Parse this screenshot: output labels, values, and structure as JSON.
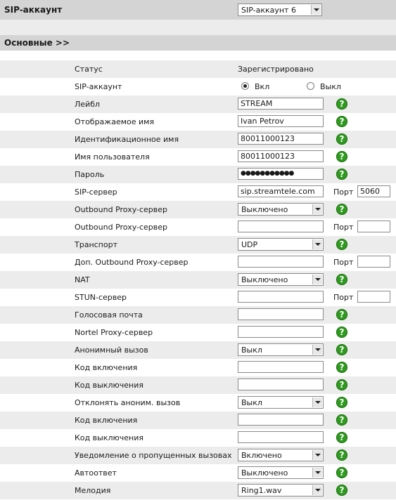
{
  "header": {
    "title": "SIP-аккаунт",
    "account_select": "SIP-аккаунт 6"
  },
  "section": {
    "title": "Основные >>"
  },
  "fields": {
    "status": {
      "label": "Статус",
      "value": "Зарегистрировано"
    },
    "sip_account": {
      "label": "SIP-аккаунт",
      "on_label": "Вкл",
      "off_label": "Выкл",
      "selected": "on"
    },
    "label": {
      "label": "Лейбл",
      "value": "STREAM"
    },
    "display_name": {
      "label": "Отображаемое имя",
      "value": "Ivan Petrov"
    },
    "auth_name": {
      "label": "Идентификационное имя",
      "value": "80011000123"
    },
    "user_name": {
      "label": "Имя пользователя",
      "value": "80011000123"
    },
    "password": {
      "label": "Пароль",
      "value": "●●●●●●●●●●●"
    },
    "sip_server": {
      "label": "SIP-сервер",
      "value": "sip.streamtele.com",
      "port_label": "Порт",
      "port": "5060"
    },
    "outbound_proxy_mode": {
      "label": "Outbound Proxy-сервер",
      "value": "Выключено"
    },
    "outbound_proxy": {
      "label": "Outbound Proxy-сервер",
      "value": "",
      "port_label": "Порт",
      "port": ""
    },
    "transport": {
      "label": "Транспорт",
      "value": "UDP"
    },
    "backup_outbound_proxy": {
      "label": "Доп. Outbound Proxy-сервер",
      "value": "",
      "port_label": "Порт",
      "port": ""
    },
    "nat": {
      "label": "NAT",
      "value": "Выключено"
    },
    "stun_server": {
      "label": "STUN-сервер",
      "value": "",
      "port_label": "Порт",
      "port": ""
    },
    "voicemail": {
      "label": "Голосовая почта",
      "value": ""
    },
    "nortel_proxy": {
      "label": "Nortel Proxy-сервер",
      "value": ""
    },
    "anonymous_call": {
      "label": "Анонимный вызов",
      "value": "Выкл"
    },
    "anon_on_code": {
      "label": "Код включения",
      "value": ""
    },
    "anon_off_code": {
      "label": "Код выключения",
      "value": ""
    },
    "reject_anonymous": {
      "label": "Отклонять аноним. вызов",
      "value": "Выкл"
    },
    "reject_on_code": {
      "label": "Код включения",
      "value": ""
    },
    "reject_off_code": {
      "label": "Код выключения",
      "value": ""
    },
    "missed_call_log": {
      "label": "Уведомление о пропущенных вызовах",
      "value": "Включено"
    },
    "auto_answer": {
      "label": "Автоответ",
      "value": "Выключено"
    },
    "ring_type": {
      "label": "Мелодия",
      "value": "Ring1.wav"
    }
  },
  "help_glyph": "?",
  "colors": {
    "help_green": "#2f9a1f",
    "bar_gray": "#d4d4d4",
    "row_alt": "#ececec"
  }
}
